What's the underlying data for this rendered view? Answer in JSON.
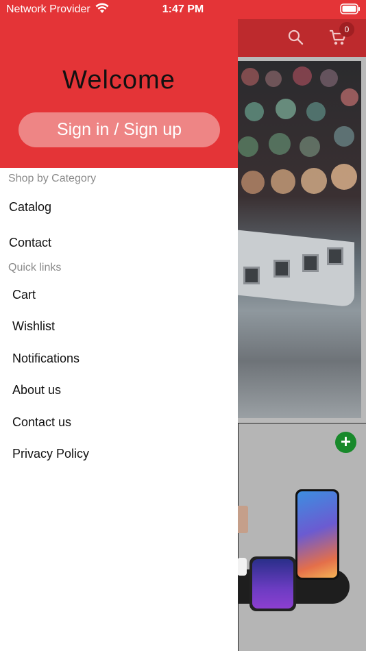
{
  "status_bar": {
    "carrier": "Network Provider",
    "time": "1:47 PM"
  },
  "app": {
    "cart_count": "0"
  },
  "drawer": {
    "welcome": "Welcome",
    "signin_label": "Sign in / Sign up",
    "shop_section_title": "Shop by Category",
    "shop_items": [
      "Catalog",
      "Contact"
    ],
    "quick_links_title": "Quick links",
    "quick_links": [
      "Cart",
      "Wishlist",
      "Notifications",
      "About us",
      "Contact us",
      "Privacy Policy"
    ]
  },
  "colors": {
    "accent_red": "#e43437",
    "signin_button": "#ee8585",
    "add_button": "#18892b"
  },
  "icons": {
    "wifi": "wifi-icon",
    "battery": "battery-icon",
    "search": "search-icon",
    "cart": "cart-icon",
    "add": "plus-icon"
  }
}
